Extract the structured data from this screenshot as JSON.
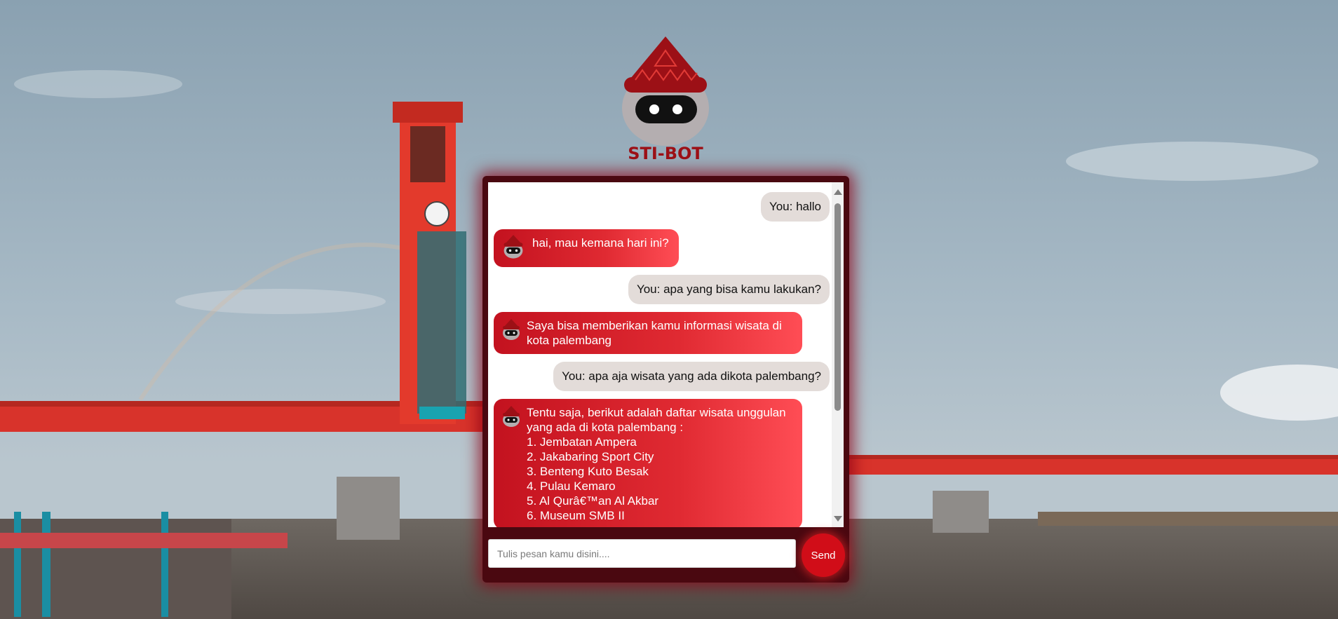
{
  "logo": {
    "text": "STI-BOT"
  },
  "messages": [
    {
      "sender": "user",
      "text": "You: hallo"
    },
    {
      "sender": "bot",
      "text": "hai, mau kemana hari ini?"
    },
    {
      "sender": "user",
      "text": "You: apa yang bisa kamu lakukan?"
    },
    {
      "sender": "bot",
      "text": "Saya bisa memberikan kamu informasi wisata di kota palembang"
    },
    {
      "sender": "user",
      "text": "You: apa aja wisata yang ada dikota palembang?"
    },
    {
      "sender": "bot",
      "text": "Tentu saja, berikut adalah daftar wisata unggulan yang ada di kota palembang :\n1. Jembatan Ampera\n2. Jakabaring Sport City\n3. Benteng Kuto Besak\n4. Pulau Kemaro\n5. Al Qurâ€™an Al Akbar\n6. Museum SMB II"
    }
  ],
  "input": {
    "placeholder": "Tulis pesan kamu disini...."
  },
  "send_button": {
    "label": "Send"
  },
  "colors": {
    "accent": "#d10d18",
    "panel": "#4a0810",
    "user_bubble": "#e3dcd9"
  }
}
